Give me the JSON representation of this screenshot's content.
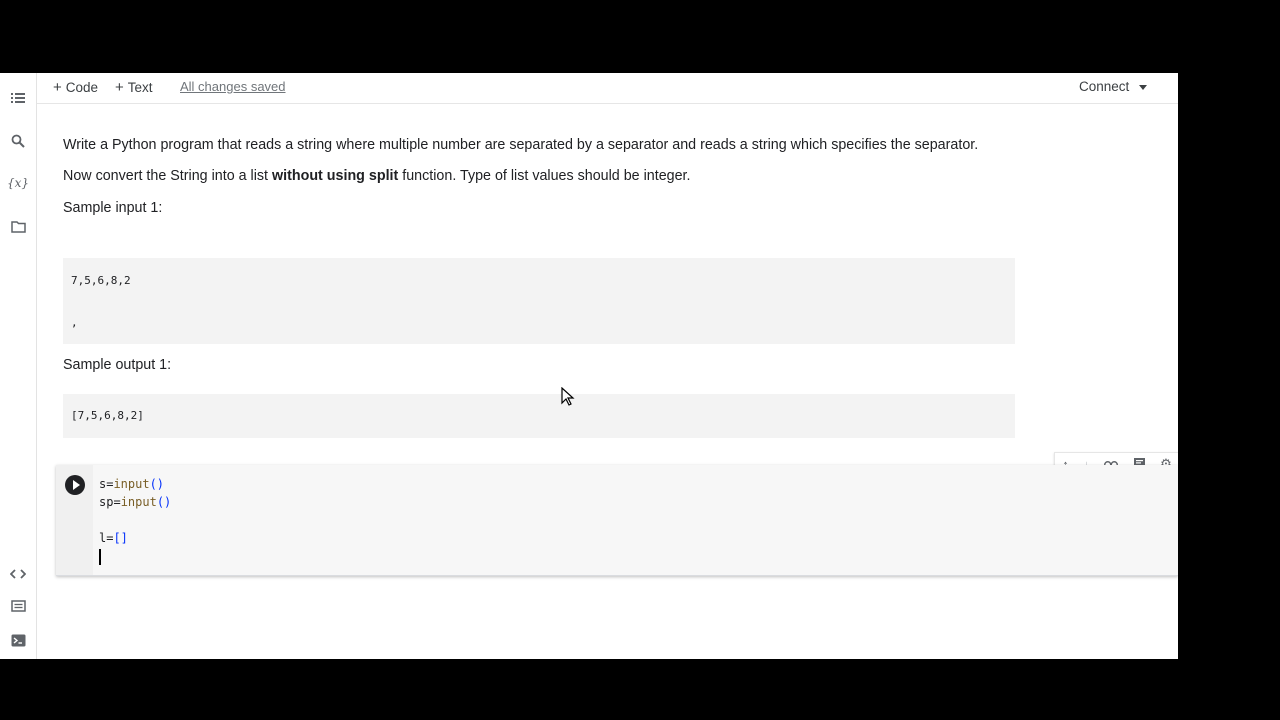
{
  "toolbar": {
    "code_label": "Code",
    "text_label": "Text",
    "saved_label": "All changes saved",
    "connect_label": "Connect"
  },
  "sidebar": {
    "icons": [
      "toc-icon",
      "search-icon",
      "variables-icon",
      "folder-icon",
      "code-snippets-icon",
      "command-palette-icon",
      "terminal-icon"
    ]
  },
  "text_cell": {
    "para1": "Write a Python program that reads a string where multiple number are separated by a separator and reads a string which specifies the separator.",
    "para2_before": "Now convert the String into a list ",
    "para2_bold": "without using split",
    "para2_after": " function. Type of list values should be integer.",
    "sample_input_label": "Sample input 1:",
    "sample_input_line1": "7,5,6,8,2",
    "sample_input_line2": ",",
    "sample_output_label": "Sample output 1:",
    "sample_output": "[7,5,6,8,2]"
  },
  "code_cell": {
    "line1_var": "s=",
    "line1_fn": "input",
    "line1_paren": "()",
    "line2_var": "sp=",
    "line2_fn": "input",
    "line2_paren": "()",
    "line3": "",
    "line4_var": "l=",
    "line4_br": "[]"
  }
}
